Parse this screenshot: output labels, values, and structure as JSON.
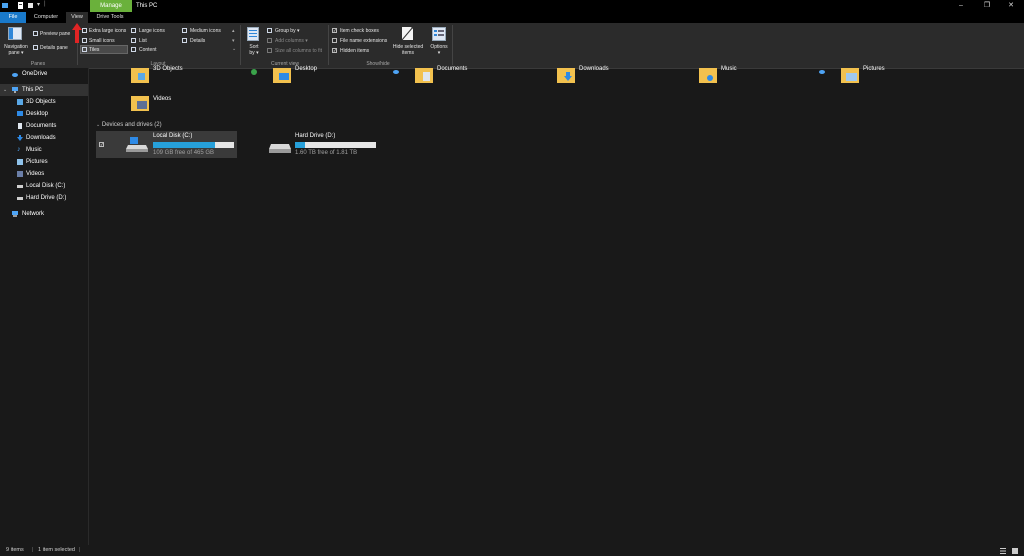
{
  "window": {
    "title": "This PC",
    "manage_tab": "Manage",
    "controls": {
      "minimize": "–",
      "maximize": "❐",
      "close": "✕"
    }
  },
  "tabs": [
    {
      "label": "File"
    },
    {
      "label": "Computer"
    },
    {
      "label": "View"
    },
    {
      "label": "Drive Tools"
    }
  ],
  "ribbon": {
    "panes": {
      "group_label": "Panes",
      "navigation_pane": "Navigation",
      "navigation_pane_2": "pane ▾",
      "preview_pane": "Preview pane",
      "details_pane": "Details pane"
    },
    "layout": {
      "group_label": "Layout",
      "extra_large_icons": "Extra large icons",
      "large_icons": "Large icons",
      "medium_icons": "Medium icons",
      "small_icons": "Small icons",
      "list": "List",
      "details": "Details",
      "tiles": "Tiles",
      "content": "Content"
    },
    "current_view": {
      "group_label": "Current view",
      "sort_by": "Sort",
      "sort_by_2": "by ▾",
      "group_by": "Group by ▾",
      "add_columns": "Add columns ▾",
      "size_columns": "Size all columns to fit"
    },
    "show_hide": {
      "group_label": "Show/hide",
      "item_check_boxes": "Item check boxes",
      "file_name_extensions": "File name extensions",
      "hidden_items": "Hidden items",
      "hide_selected": "Hide selected",
      "hide_selected_2": "items"
    },
    "options": {
      "label": "Options",
      "label_2": "▾"
    }
  },
  "sidebar": {
    "items": [
      {
        "label": "OneDrive",
        "icon": "cloud-icon"
      },
      {
        "label": "This PC",
        "icon": "computer-icon"
      },
      {
        "label": "3D Objects",
        "icon": "cube-icon"
      },
      {
        "label": "Desktop",
        "icon": "desktop-icon"
      },
      {
        "label": "Documents",
        "icon": "documents-icon"
      },
      {
        "label": "Downloads",
        "icon": "download-icon"
      },
      {
        "label": "Music",
        "icon": "music-icon"
      },
      {
        "label": "Pictures",
        "icon": "pictures-icon"
      },
      {
        "label": "Videos",
        "icon": "videos-icon"
      },
      {
        "label": "Local Disk (C:)",
        "icon": "drive-icon"
      },
      {
        "label": "Hard Drive (D:)",
        "icon": "drive-icon"
      },
      {
        "label": "Network",
        "icon": "network-icon"
      }
    ]
  },
  "folders": [
    {
      "label": "3D Objects"
    },
    {
      "label": "Desktop"
    },
    {
      "label": "Documents"
    },
    {
      "label": "Downloads"
    },
    {
      "label": "Music"
    },
    {
      "label": "Pictures"
    },
    {
      "label": "Videos"
    }
  ],
  "devices": {
    "header": "Devices and drives (2)",
    "drives": [
      {
        "name": "Local Disk (C:)",
        "free": "109 GB free of 465 GB",
        "used_fraction": 0.77,
        "selected": true
      },
      {
        "name": "Hard Drive (D:)",
        "free": "1.60 TB free of 1.81 TB",
        "used_fraction": 0.12,
        "selected": false
      }
    ]
  },
  "status": {
    "items_count": "9 items",
    "selected": "1 item selected"
  },
  "colors": {
    "accent": "#1979ca",
    "manage": "#6ab13b",
    "drive_fill": "#26a0da",
    "folder": "#f2c14e"
  }
}
